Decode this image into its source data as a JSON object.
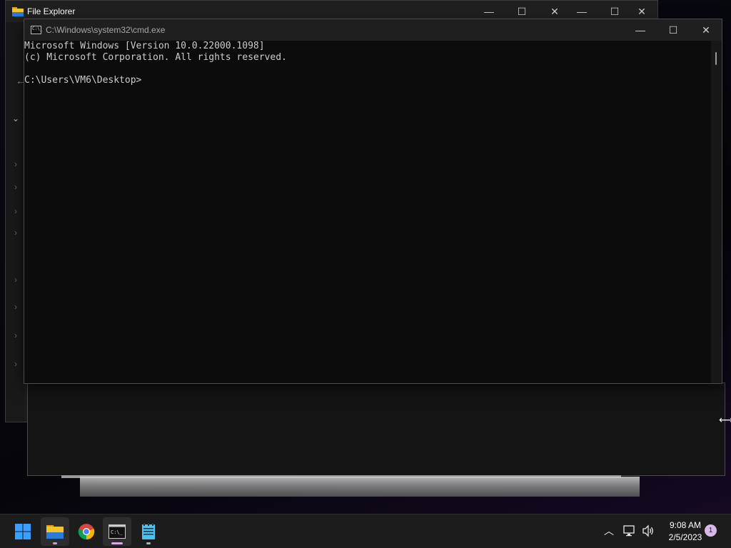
{
  "file_explorer": {
    "title": "File Explorer",
    "controls": {
      "minimize": "—",
      "maximize": "☐",
      "close": "✕"
    }
  },
  "cmd": {
    "title": "C:\\Windows\\system32\\cmd.exe",
    "icon_text": "C:\\_",
    "controls": {
      "minimize": "—",
      "maximize": "☐",
      "close": "✕"
    },
    "console_lines": [
      "Microsoft Windows [Version 10.0.22000.1098]",
      "(c) Microsoft Corporation. All rights reserved.",
      "",
      "C:\\Users\\VM6\\Desktop>"
    ]
  },
  "taskbar": {
    "apps": [
      {
        "name": "start-button",
        "icon": "windows-logo-icon"
      },
      {
        "name": "file-explorer",
        "icon": "folder-icon",
        "indicator_color": "#b0b0b0"
      },
      {
        "name": "chrome",
        "icon": "chrome-icon"
      },
      {
        "name": "command-prompt",
        "icon": "terminal-icon",
        "indicator_color": "#d8a8e8"
      },
      {
        "name": "notepad",
        "icon": "notepad-icon",
        "indicator_color": "#b0b0b0"
      }
    ],
    "tray": {
      "time": "9:08 AM",
      "date": "2/5/2023",
      "notification_count": "1"
    }
  },
  "colors": {
    "accent": "#d8b8e8",
    "console_text": "#cccccc",
    "console_bg": "#0c0c0c"
  }
}
